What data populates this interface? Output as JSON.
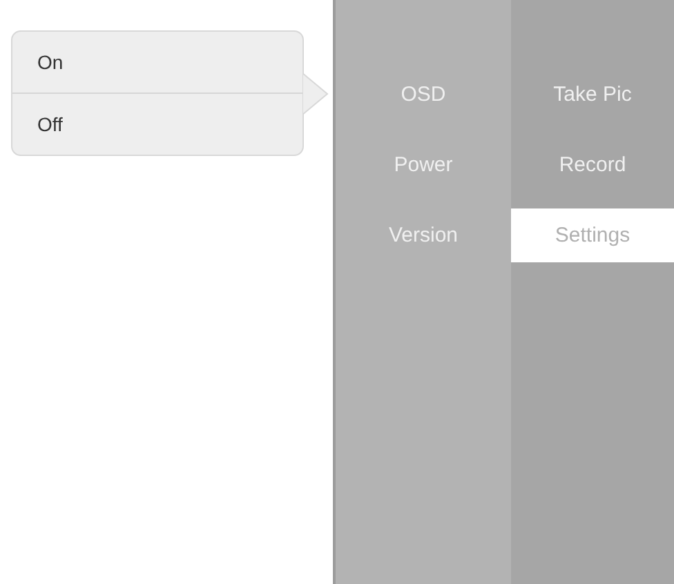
{
  "popover": {
    "options": [
      {
        "label": "On"
      },
      {
        "label": "Off"
      }
    ]
  },
  "menu": {
    "items": [
      {
        "label": "OSD"
      },
      {
        "label": "Power"
      },
      {
        "label": "Version"
      }
    ]
  },
  "submenu": {
    "items": [
      {
        "label": "Take Pic",
        "selected": false
      },
      {
        "label": "Record",
        "selected": false
      },
      {
        "label": "Settings",
        "selected": true
      }
    ]
  }
}
